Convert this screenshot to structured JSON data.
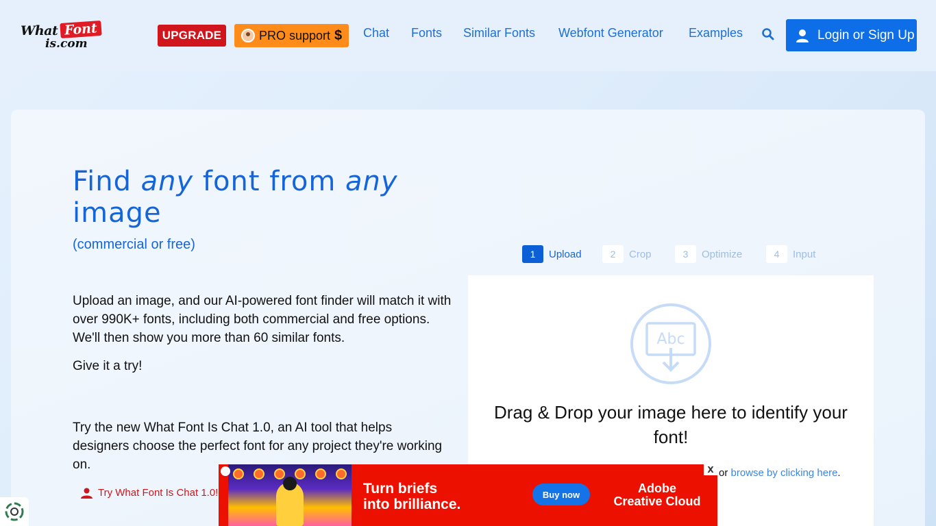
{
  "logo": {
    "what": "What",
    "font": "Font",
    "iscom": "is.com"
  },
  "header": {
    "upgrade": "UPGRADE",
    "pro_support": "PRO support",
    "pro_symbol": "$",
    "nav": [
      "Chat",
      "Fonts",
      "Similar Fonts",
      "Webfont Generator",
      "Examples"
    ],
    "login": "Login or Sign Up"
  },
  "hero": {
    "t1": "Find ",
    "t2": "any",
    "t3": " font from ",
    "t4": "any",
    "t5": " image",
    "subtitle": "(commercial or free)",
    "description": "Upload an image, and our AI-powered font finder will match it with over 990K+ fonts, including both commercial and free options. We'll then show you more than 60 similar fonts.",
    "try": "Give it a try!",
    "chat_description": "Try the new What Font Is Chat 1.0, an AI tool that helps designers choose the perfect font for any project they're working on.",
    "chat_link": "Try What Font Is Chat 1.0!"
  },
  "steps": [
    {
      "num": "1",
      "label": "Upload"
    },
    {
      "num": "2",
      "label": "Crop"
    },
    {
      "num": "3",
      "label": "Optimize"
    },
    {
      "num": "4",
      "label": "Input"
    }
  ],
  "upload": {
    "icon_text": "Abc",
    "drop_text": "Drag & Drop your image here to identify your font!",
    "or": "or ",
    "browse_link": "browse by clicking here",
    "period": "."
  },
  "ad": {
    "line1": "Turn briefs",
    "line2": "into brilliance.",
    "buy": "Buy now",
    "brand1": "Adobe",
    "brand2": "Creative Cloud",
    "close": "X"
  },
  "colors": {
    "primary": "#1565d8",
    "upgrade": "#d0151c",
    "pro": "#ff8c1a",
    "login": "#0d6ee8",
    "ad": "#eb1000"
  }
}
